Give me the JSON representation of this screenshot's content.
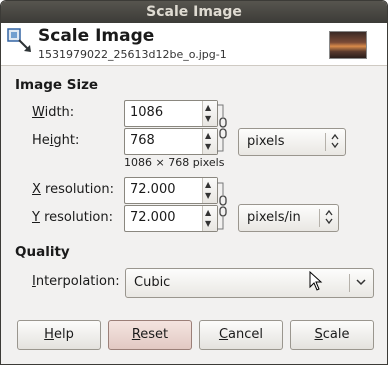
{
  "window": {
    "title": "Scale Image"
  },
  "header": {
    "title": "Scale Image",
    "subtitle": "1531979022_25613d12be_o.jpg-1"
  },
  "image_size": {
    "heading": "Image Size",
    "width_label": "Width:",
    "width_value": "1086",
    "height_label": "Height:",
    "height_value": "768",
    "unit": "pixels",
    "pixel_info": "1086 × 768 pixels",
    "x_res_label": "X resolution:",
    "x_res_value": "72.000",
    "y_res_label": "Y resolution:",
    "y_res_value": "72.000",
    "res_unit": "pixels/in"
  },
  "quality": {
    "heading": "Quality",
    "interpolation_label": "Interpolation:",
    "interpolation_value": "Cubic"
  },
  "buttons": {
    "help": "Help",
    "reset": "Reset",
    "cancel": "Cancel",
    "scale": "Scale"
  },
  "icons": [
    "scale-image-icon",
    "chain-link-icon",
    "chevron-down-icon",
    "arrow-cursor-icon"
  ]
}
